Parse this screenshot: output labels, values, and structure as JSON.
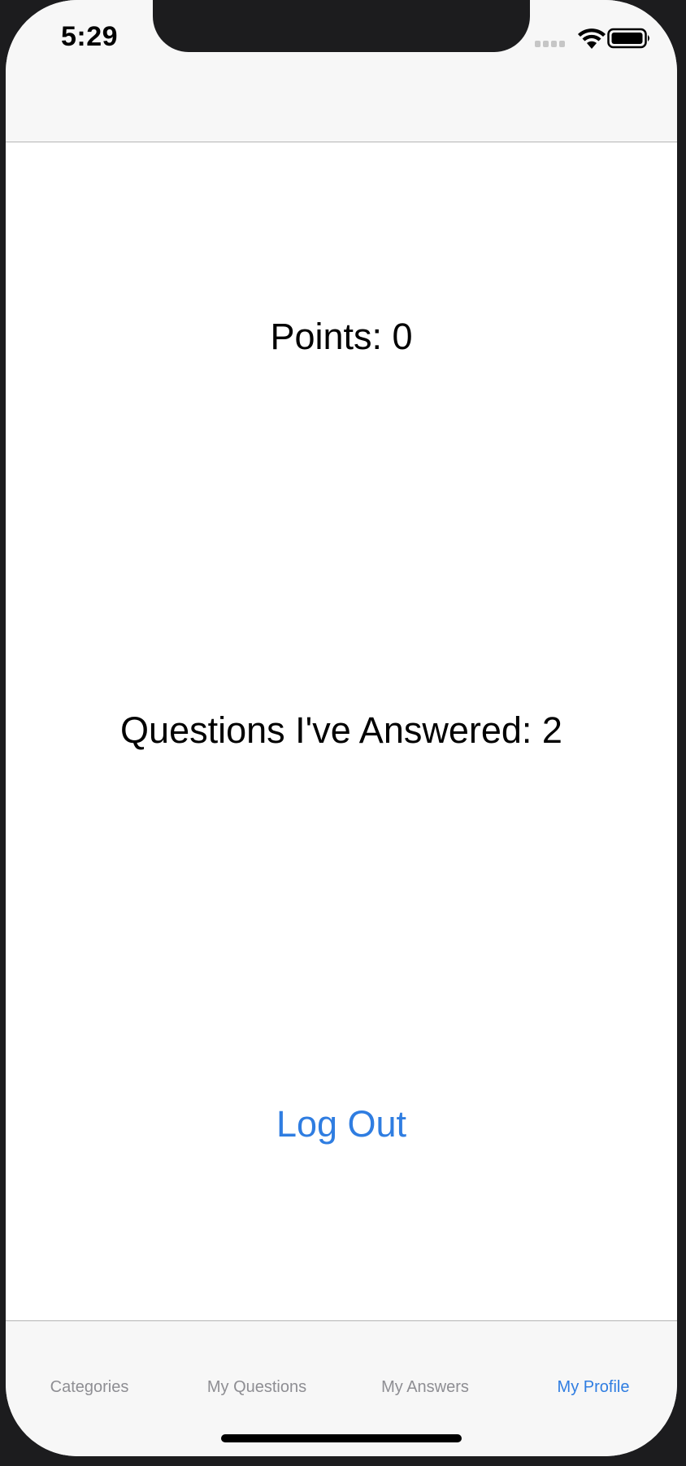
{
  "status_bar": {
    "time": "5:29",
    "icons": [
      "cellular-signal-icon",
      "wifi-icon",
      "battery-icon"
    ]
  },
  "profile": {
    "points_label": "Points: 0",
    "answered_label": "Questions I've Answered: 2",
    "logout_label": "Log Out"
  },
  "tab_bar": {
    "tabs": [
      {
        "label": "Categories",
        "active": false
      },
      {
        "label": "My Questions",
        "active": false
      },
      {
        "label": "My Answers",
        "active": false
      },
      {
        "label": "My Profile",
        "active": true
      }
    ]
  },
  "colors": {
    "accent": "#2f7de1",
    "inactive_tab": "#8e8e93",
    "bar_background": "#f7f7f7",
    "frame": "#1c1c1e"
  }
}
